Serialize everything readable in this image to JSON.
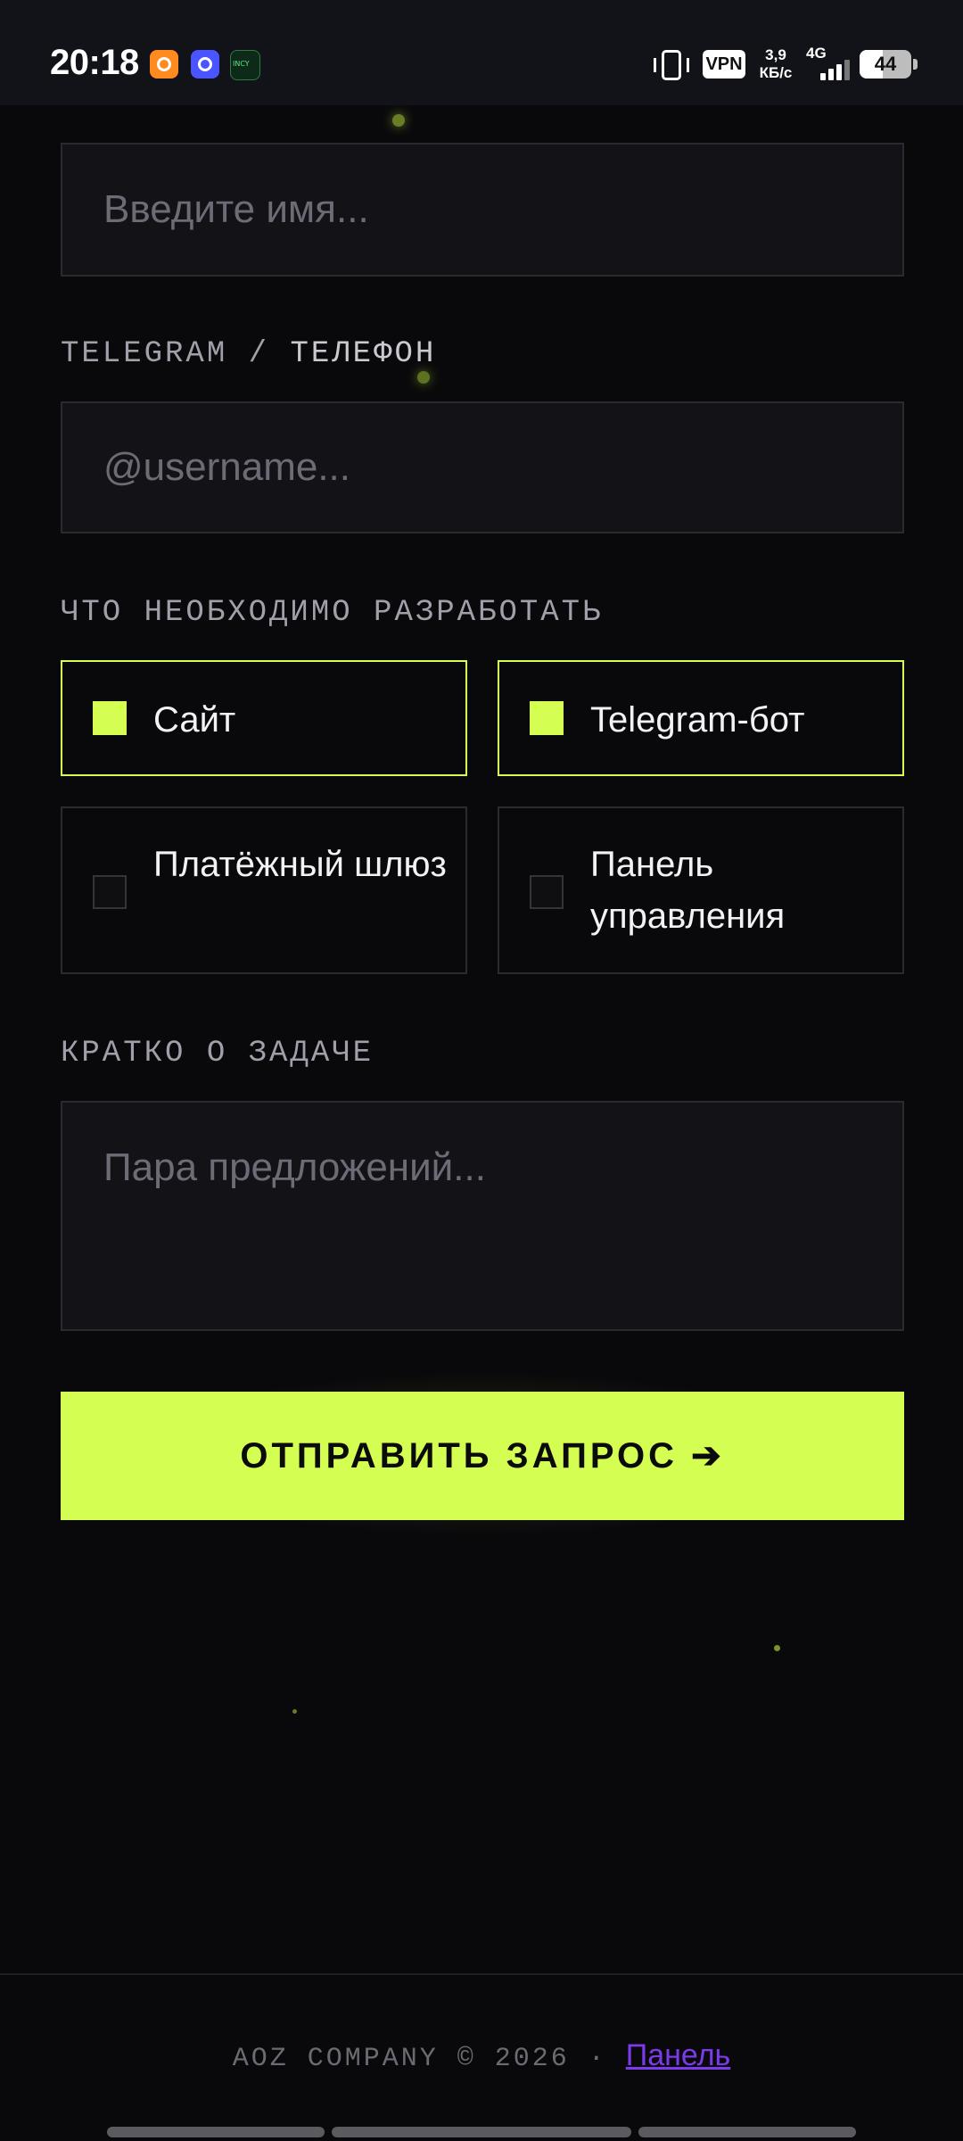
{
  "status_bar": {
    "time": "20:18",
    "vpn": "VPN",
    "speed_value": "3,9",
    "speed_unit": "КБ/с",
    "network": "4G",
    "battery": "44"
  },
  "form": {
    "name_field": {
      "placeholder": "Введите имя..."
    },
    "contact": {
      "label_part1": "TELEGRAM /",
      "label_part2": "ТЕЛЕФОН",
      "placeholder": "@username..."
    },
    "develop": {
      "label": "ЧТО НЕОБХОДИМО РАЗРАБОТАТЬ",
      "options": [
        {
          "label": "Сайт",
          "selected": true
        },
        {
          "label": "Telegram-бот",
          "selected": true
        },
        {
          "label": "Платёжный шлюз",
          "selected": false
        },
        {
          "label": "Панель управления",
          "selected": false
        }
      ]
    },
    "task": {
      "label": "КРАТКО О ЗАДАЧЕ",
      "placeholder": "Пара предложений..."
    },
    "submit_label": "ОТПРАВИТЬ ЗАПРОС ➔"
  },
  "footer": {
    "copyright": "AOZ COMPANY © 2026 ·",
    "link": "Панель"
  },
  "colors": {
    "accent": "#d4ff52",
    "background": "#09090b",
    "link": "#7c3aed"
  }
}
